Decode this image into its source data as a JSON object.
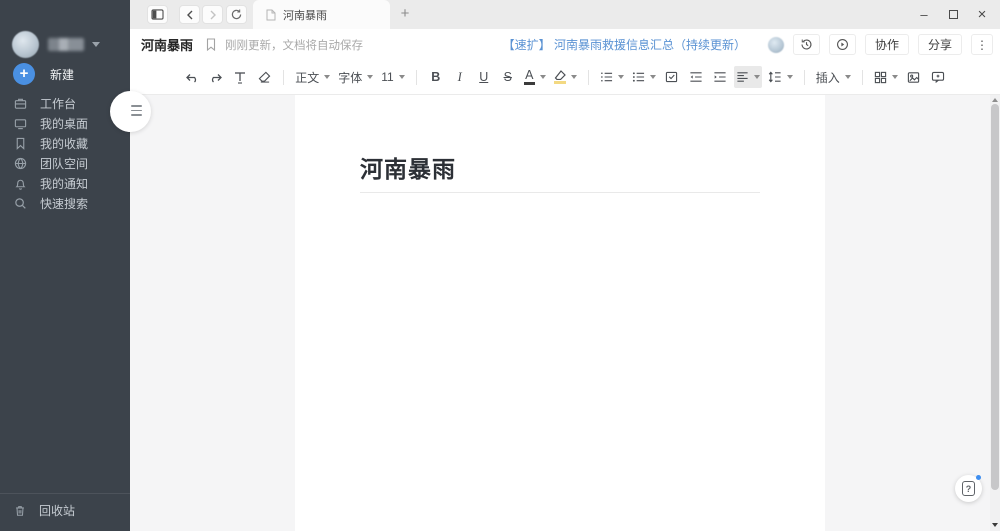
{
  "window": {
    "minimize_glyph": "–",
    "close_glyph": "×"
  },
  "sidebar": {
    "new_button": {
      "label": "新建",
      "plus_glyph": "+"
    },
    "items": [
      {
        "label": "工作台",
        "icon": "workbench-icon"
      },
      {
        "label": "我的桌面",
        "icon": "desktop-icon"
      },
      {
        "label": "我的收藏",
        "icon": "favorites-icon"
      },
      {
        "label": "团队空间",
        "icon": "team-space-icon"
      },
      {
        "label": "我的通知",
        "icon": "notifications-icon"
      },
      {
        "label": "快速搜索",
        "icon": "search-icon"
      }
    ],
    "recycle_bin": {
      "label": "回收站",
      "icon": "trash-icon"
    }
  },
  "tabbar": {
    "active_tab_title": "河南暴雨",
    "new_tab_glyph": "+"
  },
  "header": {
    "doc_title": "河南暴雨",
    "autosave_status": "刚刚更新，文档将自动保存",
    "announcement_link": "【速扩】 河南暴雨救援信息汇总（持续更新）",
    "collaborate_label": "协作",
    "share_label": "分享",
    "more_glyph": "⋮"
  },
  "toolbar": {
    "paragraph_style": "正文",
    "font_family_label": "字体",
    "font_size": "11",
    "bold_glyph": "B",
    "italic_glyph": "I",
    "underline_glyph": "U",
    "strikethrough_glyph": "S",
    "font_color_glyph": "A",
    "insert_label": "插入"
  },
  "document": {
    "title": "河南暴雨"
  },
  "help": {
    "glyph": "?"
  },
  "colors": {
    "sidebar_bg": "#3c434b",
    "accent_blue": "#4a90e2",
    "link_blue": "#5a92d3",
    "tabbar_bg": "#ebebeb",
    "content_bg": "#f5f5f6",
    "highlight_yellow": "#f3d982"
  }
}
